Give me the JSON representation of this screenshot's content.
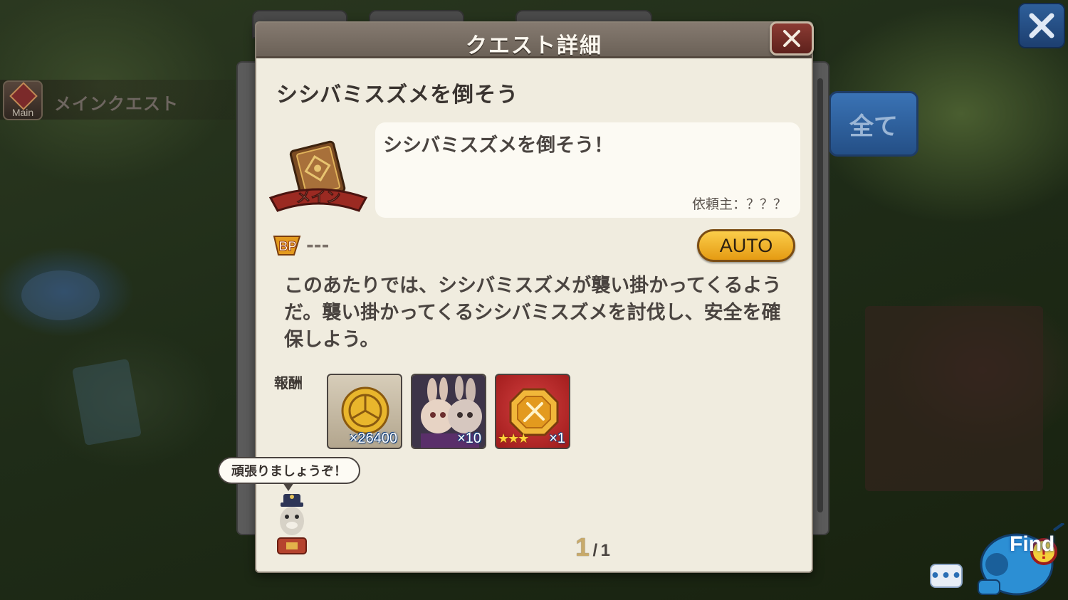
{
  "side": {
    "icon_label": "Main",
    "label": "メインクエスト"
  },
  "filter_button": "全て",
  "dialog": {
    "title": "クエスト詳細",
    "quest_title": "シシバミスズメを倒そう",
    "badge_label": "メイン",
    "description": "シシバミスズメを倒そう！",
    "client": "依頼主：？？？",
    "bp_label": "BP",
    "bp_value": "---",
    "auto_label": "AUTO",
    "body": "このあたりでは、シシバミスズメが襲い掛かってくるようだ。襲い掛かってくるシシバミスズメを討伐し、安全を確保しよう。",
    "reward_label": "報酬",
    "rewards": [
      {
        "icon": "gold-coin-icon",
        "qty": "×26400"
      },
      {
        "icon": "rabbit-characters-icon",
        "qty": "×10"
      },
      {
        "icon": "medal-icon",
        "qty": "×1",
        "stars": "★★★"
      }
    ],
    "speech": "頑張りましょうぞ！",
    "page_current": "1",
    "page_sep": "/",
    "page_total": "1"
  },
  "chat_label": "•••",
  "find_label": "Find",
  "colors": {
    "header": "#766b61",
    "panel": "#f0ecdf",
    "auto": "#f2b22e",
    "close": "#7a2d26",
    "accent_blue": "#2e5f9a"
  }
}
